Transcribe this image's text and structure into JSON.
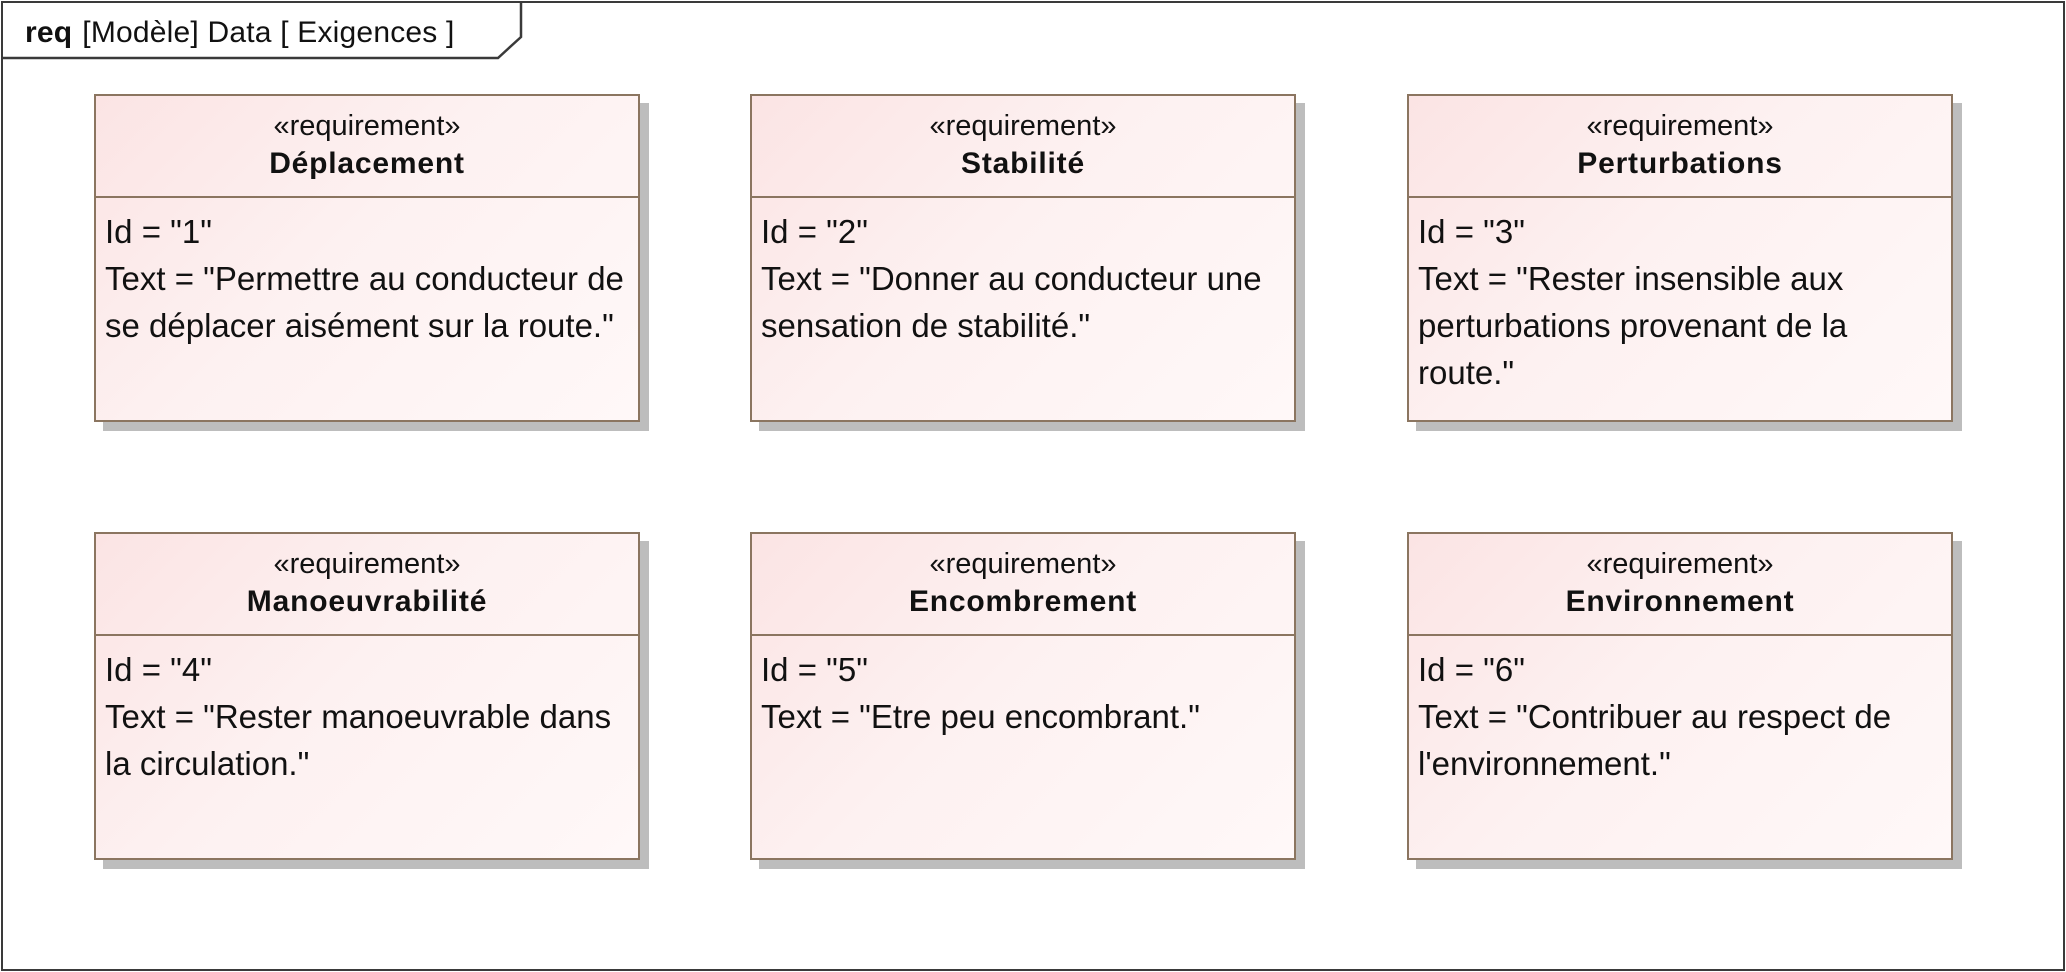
{
  "diagram": {
    "kind": "req",
    "label": "[Modèle] Data [ Exigences ]"
  },
  "requirements": [
    {
      "stereotype": "«requirement»",
      "name": "Déplacement",
      "id_line": "Id = \"1\"",
      "text_line": "Text = \"Permettre au conducteur de se déplacer aisément sur la route.\""
    },
    {
      "stereotype": "«requirement»",
      "name": "Stabilité",
      "id_line": "Id = \"2\"",
      "text_line": "Text = \"Donner au conducteur une sensation de stabilité.\""
    },
    {
      "stereotype": "«requirement»",
      "name": "Perturbations",
      "id_line": "Id = \"3\"",
      "text_line": "Text = \"Rester insensible aux perturbations provenant de la route.\""
    },
    {
      "stereotype": "«requirement»",
      "name": "Manoeuvrabilité",
      "id_line": "Id = \"4\"",
      "text_line": "Text = \"Rester manoeuvrable dans la circulation.\""
    },
    {
      "stereotype": "«requirement»",
      "name": "Encombrement",
      "id_line": "Id = \"5\"",
      "text_line": "Text = \"Etre peu encombrant.\""
    },
    {
      "stereotype": "«requirement»",
      "name": "Environnement",
      "id_line": "Id = \"6\"",
      "text_line": "Text = \"Contribuer au respect de l'environnement.\""
    }
  ]
}
